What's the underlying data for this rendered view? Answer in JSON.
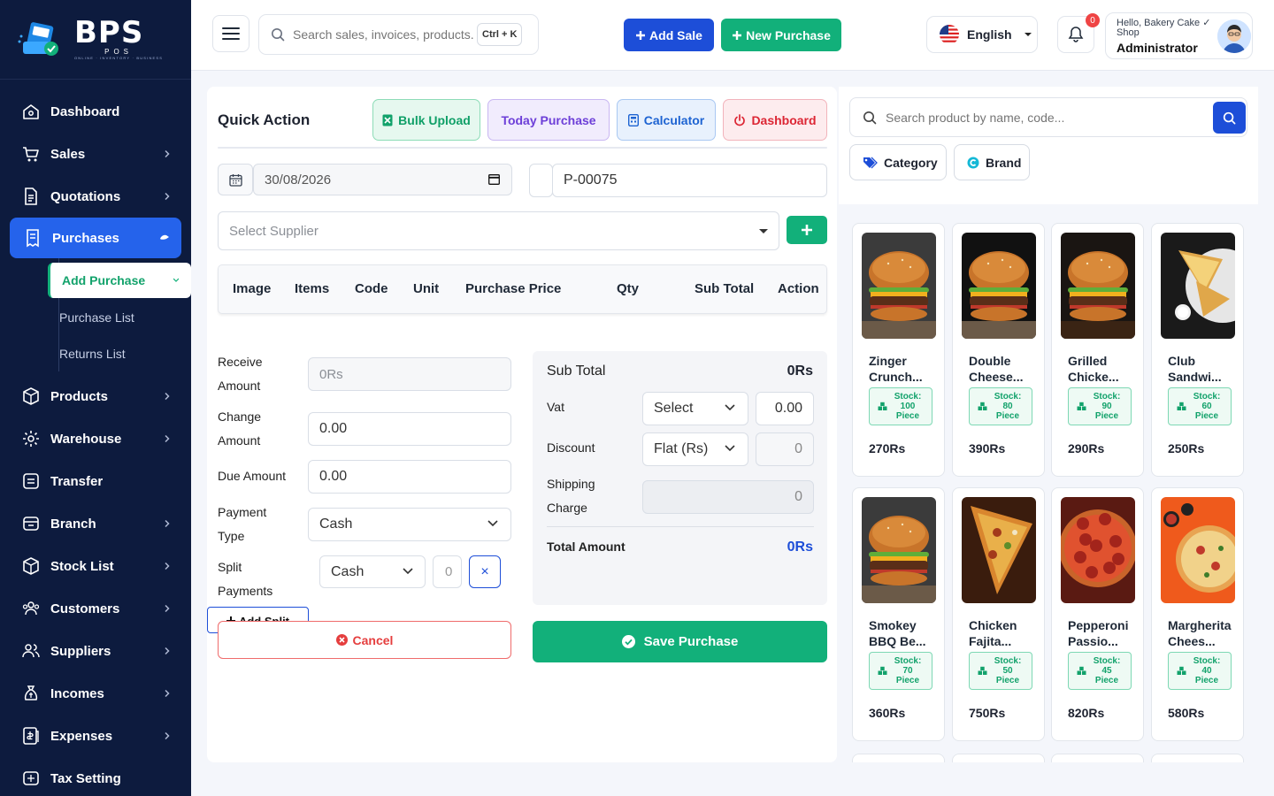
{
  "brand": {
    "name": "BPS",
    "sub": "POS",
    "tagline": "ONLINE · INVENTORY · BUSINESS"
  },
  "sidebar": {
    "items": [
      {
        "label": "Dashboard",
        "icon": "home-icon",
        "chevron": false
      },
      {
        "label": "Sales",
        "icon": "cart-icon",
        "chevron": true
      },
      {
        "label": "Quotations",
        "icon": "document-icon",
        "chevron": true
      },
      {
        "label": "Purchases",
        "icon": "receipt-icon",
        "chevron": true,
        "active": true
      },
      {
        "label": "Products",
        "icon": "box-icon",
        "chevron": true
      },
      {
        "label": "Warehouse",
        "icon": "warehouse-icon",
        "chevron": true
      },
      {
        "label": "Transfer",
        "icon": "transfer-icon",
        "chevron": false
      },
      {
        "label": "Branch",
        "icon": "branch-icon",
        "chevron": true
      },
      {
        "label": "Stock List",
        "icon": "stock-icon",
        "chevron": true
      },
      {
        "label": "Customers",
        "icon": "customers-icon",
        "chevron": true
      },
      {
        "label": "Suppliers",
        "icon": "suppliers-icon",
        "chevron": true
      },
      {
        "label": "Incomes",
        "icon": "income-icon",
        "chevron": true
      },
      {
        "label": "Expenses",
        "icon": "expense-icon",
        "chevron": true
      },
      {
        "label": "Tax Setting",
        "icon": "tax-icon",
        "chevron": false
      }
    ],
    "purchase_sub": [
      "Add Purchase",
      "Purchase List",
      "Returns List"
    ]
  },
  "header": {
    "search_placeholder": "Search sales, invoices, products...",
    "shortcut": "Ctrl + K",
    "add_sale": "Add Sale",
    "new_purchase": "New Purchase",
    "language": "English",
    "notifications": "0",
    "greeting": "Hello, Bakery Cake ✓ Shop",
    "role": "Administrator"
  },
  "quick_action": {
    "title": "Quick Action",
    "bulk_upload": "Bulk Upload",
    "today_purchase": "Today Purchase",
    "calculator": "Calculator",
    "dashboard": "Dashboard"
  },
  "form": {
    "date": "30/08/2026",
    "ref": "P-00075",
    "supplier_placeholder": "Select Supplier",
    "columns": [
      "Image",
      "Items",
      "Code",
      "Unit",
      "Purchase Price",
      "Qty",
      "Sub Total",
      "Action"
    ],
    "receive_label": "Receive Amount",
    "receive_placeholder": "0Rs",
    "change_label": "Change Amount",
    "change_value": "0.00",
    "due_label": "Due Amount",
    "due_value": "0.00",
    "payment_type_label": "Payment Type",
    "payment_type": "Cash",
    "split_label": "Split Payments",
    "split_method": "Cash",
    "split_amount": "0",
    "remove": "×",
    "add_split": "Add Split",
    "cancel": "Cancel",
    "save": "Save Purchase"
  },
  "summary": {
    "subtotal_label": "Sub Total",
    "subtotal": "0Rs",
    "vat_label": "Vat",
    "vat_select": "Select",
    "vat_value": "0.00",
    "discount_label": "Discount",
    "discount_select": "Flat (Rs)",
    "discount_value": "0",
    "shipping_label": "Shipping Charge",
    "shipping_value": "0",
    "total_label": "Total Amount",
    "total": "0Rs"
  },
  "products": {
    "search_placeholder": "Search product by name, code...",
    "category": "Category",
    "brand": "Brand",
    "items": [
      {
        "name": "Zinger Crunch...",
        "stock": "Stock: 100 Piece",
        "price": "270Rs",
        "art": "burger"
      },
      {
        "name": "Double Cheese...",
        "stock": "Stock: 80 Piece",
        "price": "390Rs",
        "art": "burger"
      },
      {
        "name": "Grilled Chicke...",
        "stock": "Stock: 90 Piece",
        "price": "290Rs",
        "art": "burger-dark"
      },
      {
        "name": "Club Sandwi...",
        "stock": "Stock: 60 Piece",
        "price": "250Rs",
        "art": "sandwich"
      },
      {
        "name": "Smokey BBQ Be...",
        "stock": "Stock: 70 Piece",
        "price": "360Rs",
        "art": "burger"
      },
      {
        "name": "Chicken Fajita...",
        "stock": "Stock: 50 Piece",
        "price": "750Rs",
        "art": "pizza-slice"
      },
      {
        "name": "Pepperoni Passio...",
        "stock": "Stock: 45 Piece",
        "price": "820Rs",
        "art": "pepperoni"
      },
      {
        "name": "Margherita Chees...",
        "stock": "Stock: 40 Piece",
        "price": "580Rs",
        "art": "margherita"
      }
    ]
  },
  "colors": {
    "sidebar": "#0d1b3e",
    "primary": "#1d4ed8",
    "success": "#12b07a",
    "danger": "#e53e3e"
  }
}
